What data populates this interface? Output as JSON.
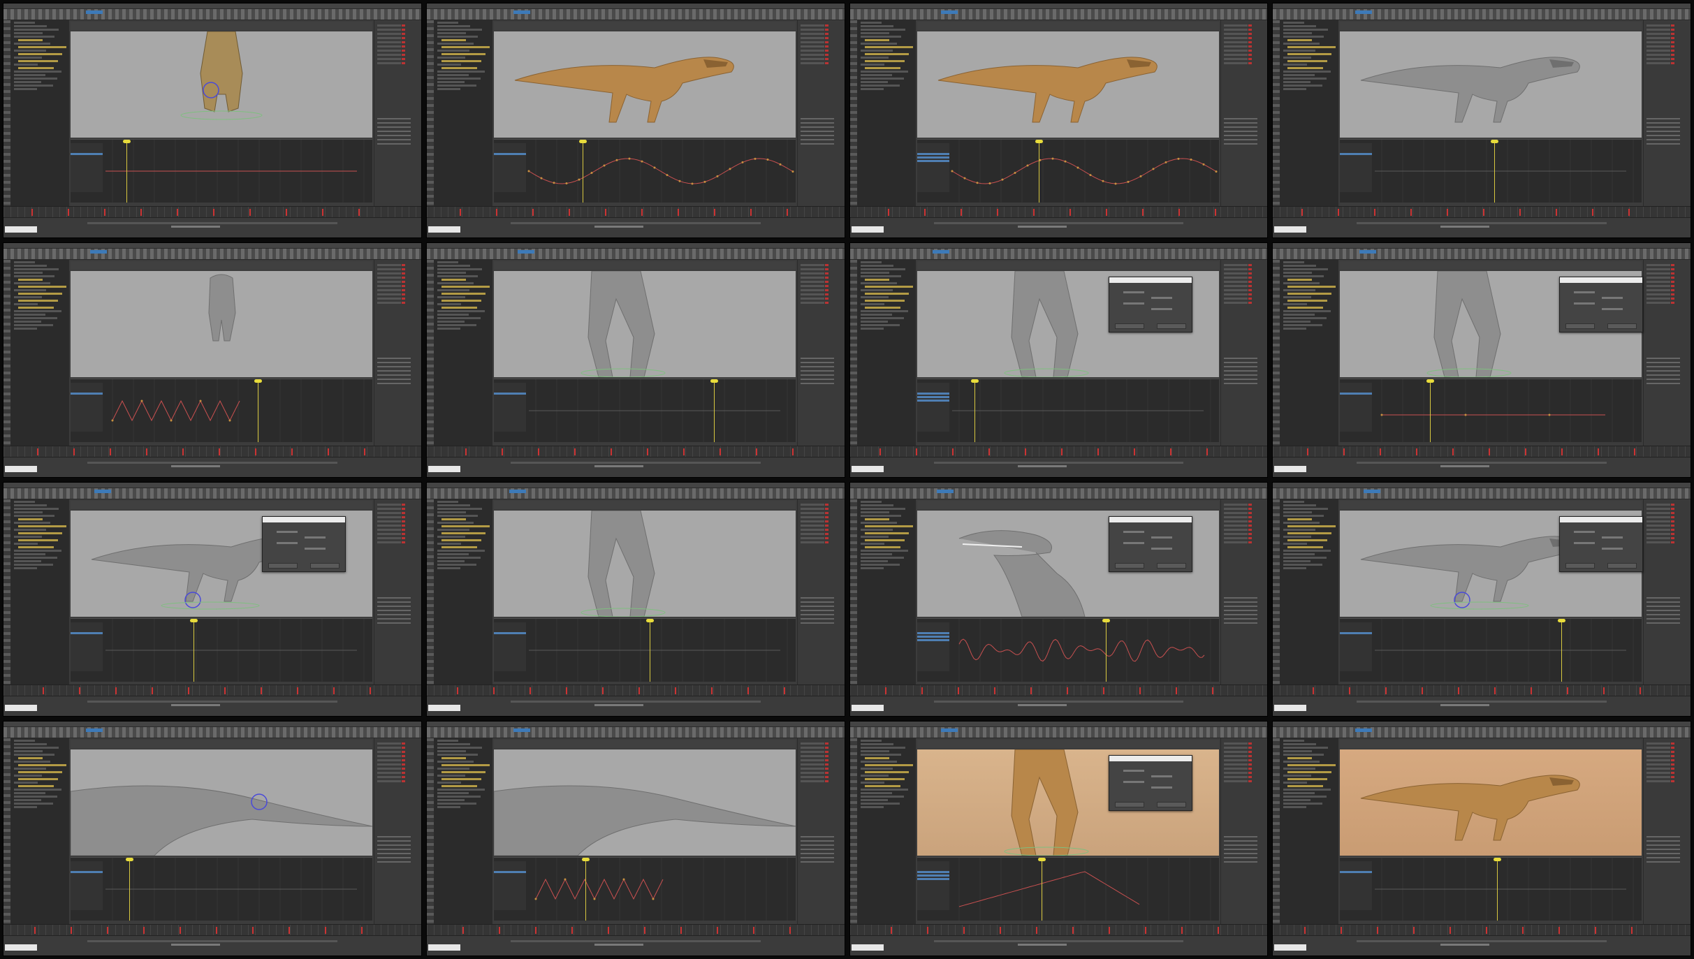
{
  "contact_sheet": {
    "columns": 4,
    "rows": 4,
    "frames": [
      {
        "id": "f1",
        "viewport_style": "gray",
        "subject": "dino-front-rig",
        "curve": "none",
        "dialog": false
      },
      {
        "id": "f2",
        "viewport_style": "gray",
        "subject": "dino-textured-side",
        "curve": "wave",
        "dialog": false
      },
      {
        "id": "f3",
        "viewport_style": "gray",
        "subject": "dino-textured-side",
        "curve": "wave",
        "dialog": false
      },
      {
        "id": "f4",
        "viewport_style": "gray",
        "subject": "dino-gray-side",
        "curve": "flat",
        "dialog": false
      },
      {
        "id": "f5",
        "viewport_style": "gray",
        "subject": "dino-gray-front",
        "curve": "zigzag",
        "dialog": false
      },
      {
        "id": "f6",
        "viewport_style": "gray",
        "subject": "dino-hands-closeup",
        "curve": "flat",
        "dialog": false
      },
      {
        "id": "f7",
        "viewport_style": "gray",
        "subject": "dino-feet-closeup",
        "curve": "flat",
        "dialog": true
      },
      {
        "id": "f8",
        "viewport_style": "gray",
        "subject": "dino-legs-closeup",
        "curve": "dots",
        "dialog": true
      },
      {
        "id": "f9",
        "viewport_style": "gray",
        "subject": "dino-gray-side-rig",
        "curve": "flat",
        "dialog": true
      },
      {
        "id": "f10",
        "viewport_style": "gray",
        "subject": "dino-torso-closeup",
        "curve": "flat",
        "dialog": false
      },
      {
        "id": "f11",
        "viewport_style": "gray",
        "subject": "dino-head",
        "curve": "noise",
        "dialog": true
      },
      {
        "id": "f12",
        "viewport_style": "gray",
        "subject": "dino-gray-side-rig",
        "curve": "flat",
        "dialog": true
      },
      {
        "id": "f13",
        "viewport_style": "gray",
        "subject": "dino-tail-rig",
        "curve": "flat",
        "dialog": false
      },
      {
        "id": "f14",
        "viewport_style": "gray",
        "subject": "dino-tail-closeup",
        "curve": "zigzag",
        "dialog": false
      },
      {
        "id": "f15",
        "viewport_style": "sand",
        "subject": "dino-textured-legs",
        "curve": "ramp",
        "dialog": true
      },
      {
        "id": "f16",
        "viewport_style": "sand2",
        "subject": "dino-textured-side",
        "curve": "flat",
        "dialog": false
      }
    ]
  },
  "colors": {
    "maya_panel": "#3c3c3c",
    "viewport_gray": "#a8a8a8",
    "selection_blue": "#4f7fb3",
    "playhead_yellow": "#e8dc3c",
    "key_red": "#cc3333",
    "curve_red": "#c85050",
    "curve_orange": "#c89040"
  },
  "icons": {
    "viewport": "3d-viewport-icon",
    "graph": "graph-editor-icon",
    "timeline": "timeline-icon"
  }
}
